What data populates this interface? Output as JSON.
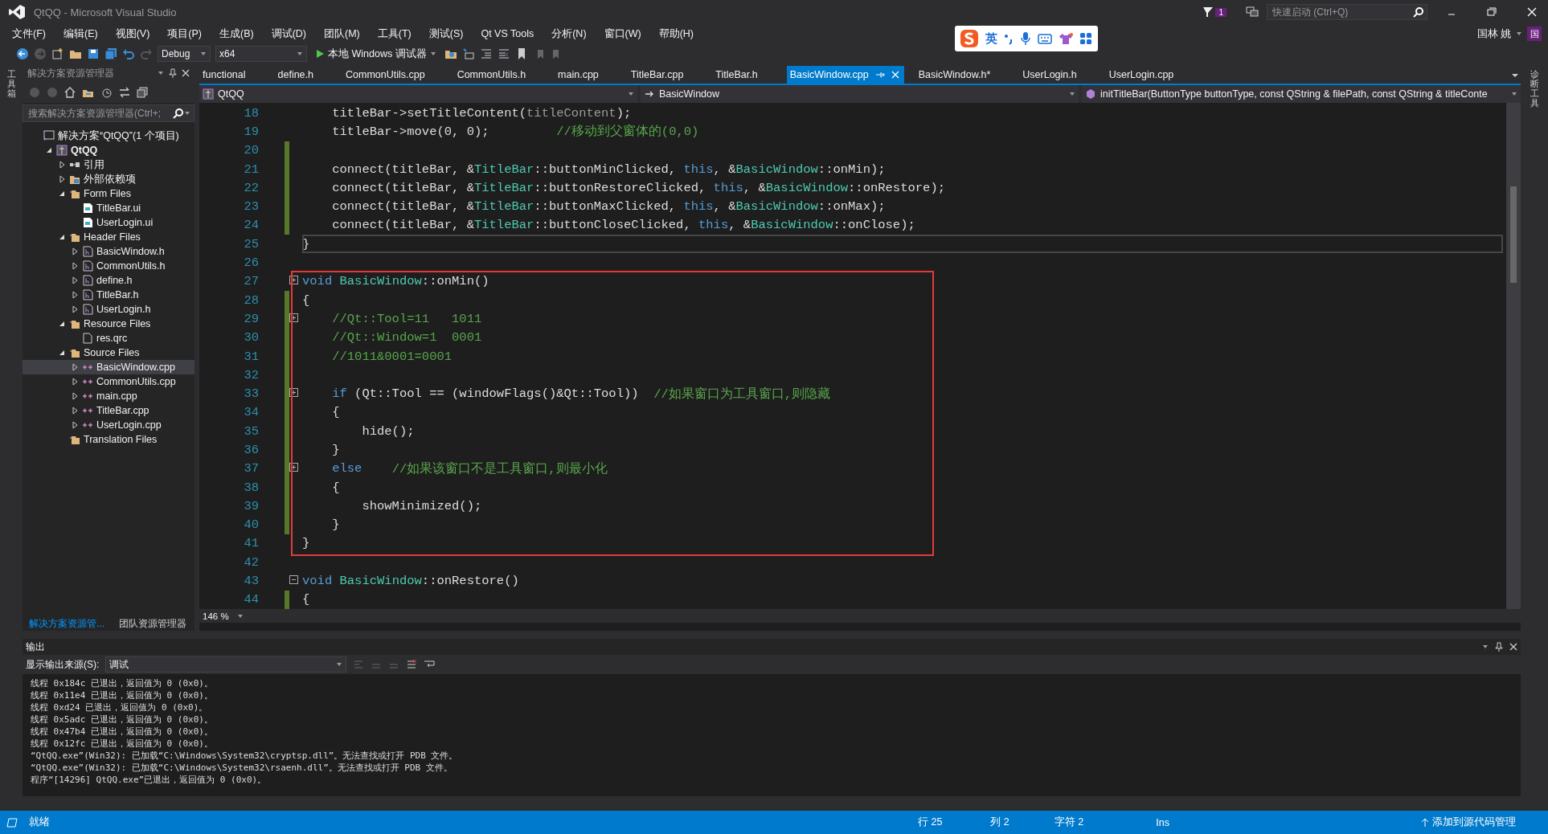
{
  "window": {
    "title": "QtQQ - Microsoft Visual Studio"
  },
  "notifications": {
    "count": "1"
  },
  "quick_launch": {
    "placeholder": "快速启动 (Ctrl+Q)"
  },
  "user": {
    "name": "国林 姚",
    "avatar": "国"
  },
  "ime_bar": {
    "mode": "英"
  },
  "menu": [
    "文件(F)",
    "编辑(E)",
    "视图(V)",
    "项目(P)",
    "生成(B)",
    "调试(D)",
    "团队(M)",
    "工具(T)",
    "测试(S)",
    "Qt VS Tools",
    "分析(N)",
    "窗口(W)",
    "帮助(H)"
  ],
  "toolbar": {
    "configuration": "Debug",
    "platform": "x64",
    "debugger": "本地 Windows 调试器"
  },
  "left_strip": {
    "label": "工具箱"
  },
  "right_strip": {
    "label": "诊断工具"
  },
  "solution_explorer": {
    "title": "解决方案资源管理器",
    "search": {
      "placeholder": "搜索解决方案资源管理器(Ctrl+;"
    },
    "tree": [
      {
        "label": "解决方案“QtQQ”(1 个项目)",
        "kind": "solution",
        "selected": false,
        "children": [
          {
            "label": "QtQQ",
            "kind": "project",
            "expanded": true,
            "selected": false,
            "children": [
              {
                "label": "引用",
                "kind": "references",
                "expanded": false,
                "selected": false
              },
              {
                "label": "外部依赖项",
                "kind": "external",
                "expanded": false,
                "selected": false
              },
              {
                "label": "Form Files",
                "kind": "folder",
                "expanded": true,
                "selected": false,
                "children": [
                  {
                    "label": "TitleBar.ui",
                    "kind": "ui",
                    "selected": false
                  },
                  {
                    "label": "UserLogin.ui",
                    "kind": "ui",
                    "selected": false
                  }
                ]
              },
              {
                "label": "Header Files",
                "kind": "folder",
                "expanded": true,
                "selected": false,
                "children": [
                  {
                    "label": "BasicWindow.h",
                    "kind": "header",
                    "expanded": false,
                    "selected": false
                  },
                  {
                    "label": "CommonUtils.h",
                    "kind": "header",
                    "expanded": false,
                    "selected": false
                  },
                  {
                    "label": "define.h",
                    "kind": "header",
                    "expanded": false,
                    "selected": false
                  },
                  {
                    "label": "TitleBar.h",
                    "kind": "header",
                    "expanded": false,
                    "selected": false
                  },
                  {
                    "label": "UserLogin.h",
                    "kind": "header",
                    "expanded": false,
                    "selected": false
                  }
                ]
              },
              {
                "label": "Resource Files",
                "kind": "folder",
                "expanded": true,
                "selected": false,
                "children": [
                  {
                    "label": "res.qrc",
                    "kind": "file",
                    "selected": false
                  }
                ]
              },
              {
                "label": "Source Files",
                "kind": "folder",
                "expanded": true,
                "selected": false,
                "children": [
                  {
                    "label": "BasicWindow.cpp",
                    "kind": "source",
                    "expanded": false,
                    "selected": true
                  },
                  {
                    "label": "CommonUtils.cpp",
                    "kind": "source",
                    "expanded": false,
                    "selected": false
                  },
                  {
                    "label": "main.cpp",
                    "kind": "source",
                    "expanded": false,
                    "selected": false
                  },
                  {
                    "label": "TitleBar.cpp",
                    "kind": "source",
                    "expanded": false,
                    "selected": false
                  },
                  {
                    "label": "UserLogin.cpp",
                    "kind": "source",
                    "expanded": false,
                    "selected": false
                  }
                ]
              },
              {
                "label": "Translation Files",
                "kind": "folder",
                "selected": false
              }
            ]
          }
        ]
      }
    ],
    "tabs": [
      {
        "label": "解决方案资源管...",
        "selected": true
      },
      {
        "label": "团队资源管理器",
        "selected": false
      }
    ]
  },
  "editor": {
    "tabs": [
      {
        "label": "functional",
        "selected": false
      },
      {
        "label": "define.h",
        "selected": false
      },
      {
        "label": "CommonUtils.cpp",
        "selected": false
      },
      {
        "label": "CommonUtils.h",
        "selected": false
      },
      {
        "label": "main.cpp",
        "selected": false
      },
      {
        "label": "TitleBar.cpp",
        "selected": false
      },
      {
        "label": "TitleBar.h",
        "selected": false
      },
      {
        "label": "BasicWindow.cpp",
        "selected": true
      },
      {
        "label": "BasicWindow.h*",
        "selected": false
      },
      {
        "label": "UserLogin.h",
        "selected": false
      },
      {
        "label": "UserLogin.cpp",
        "selected": false
      }
    ],
    "nav": {
      "project": "QtQQ",
      "class": "BasicWindow",
      "member": "initTitleBar(ButtonType buttonType, const QString & filePath, const QString & titleConte"
    },
    "lines": [
      {
        "number": "18",
        "changed": false,
        "current": false,
        "boxed": false,
        "tokens": [
          {
            "kind": "text",
            "text": "    titleBar->setTitleContent("
          },
          {
            "kind": "param",
            "text": "titleContent"
          },
          {
            "kind": "text",
            "text": ");"
          }
        ]
      },
      {
        "number": "19",
        "changed": false,
        "current": false,
        "boxed": false,
        "tokens": [
          {
            "kind": "text",
            "text": "    titleBar->move(0, 0);         "
          },
          {
            "kind": "comment",
            "text": "//移动到父窗体的(0,0)"
          }
        ]
      },
      {
        "number": "20",
        "changed": true,
        "current": false,
        "boxed": false
      },
      {
        "number": "21",
        "changed": true,
        "current": false,
        "boxed": false,
        "tokens": [
          {
            "kind": "text",
            "text": "    connect(titleBar, &"
          },
          {
            "kind": "type",
            "text": "TitleBar"
          },
          {
            "kind": "text",
            "text": "::buttonMinClicked, "
          },
          {
            "kind": "keyword",
            "text": "this"
          },
          {
            "kind": "text",
            "text": ", &"
          },
          {
            "kind": "type",
            "text": "BasicWindow"
          },
          {
            "kind": "text",
            "text": "::onMin);"
          }
        ]
      },
      {
        "number": "22",
        "changed": true,
        "current": false,
        "boxed": false,
        "tokens": [
          {
            "kind": "text",
            "text": "    connect(titleBar, &"
          },
          {
            "kind": "type",
            "text": "TitleBar"
          },
          {
            "kind": "text",
            "text": "::buttonRestoreClicked, "
          },
          {
            "kind": "keyword",
            "text": "this"
          },
          {
            "kind": "text",
            "text": ", &"
          },
          {
            "kind": "type",
            "text": "BasicWindow"
          },
          {
            "kind": "text",
            "text": "::onRestore);"
          }
        ]
      },
      {
        "number": "23",
        "changed": true,
        "current": false,
        "boxed": false,
        "tokens": [
          {
            "kind": "text",
            "text": "    connect(titleBar, &"
          },
          {
            "kind": "type",
            "text": "TitleBar"
          },
          {
            "kind": "text",
            "text": "::buttonMaxClicked, "
          },
          {
            "kind": "keyword",
            "text": "this"
          },
          {
            "kind": "text",
            "text": ", &"
          },
          {
            "kind": "type",
            "text": "BasicWindow"
          },
          {
            "kind": "text",
            "text": "::onMax);"
          }
        ]
      },
      {
        "number": "24",
        "changed": true,
        "current": false,
        "boxed": false,
        "tokens": [
          {
            "kind": "text",
            "text": "    connect(titleBar, &"
          },
          {
            "kind": "type",
            "text": "TitleBar"
          },
          {
            "kind": "text",
            "text": "::buttonCloseClicked, "
          },
          {
            "kind": "keyword",
            "text": "this"
          },
          {
            "kind": "text",
            "text": ", &"
          },
          {
            "kind": "type",
            "text": "BasicWindow"
          },
          {
            "kind": "text",
            "text": "::onClose);"
          }
        ]
      },
      {
        "number": "25",
        "changed": false,
        "current": true,
        "boxed": false,
        "tokens": [
          {
            "kind": "text",
            "text": "}"
          }
        ]
      },
      {
        "number": "26",
        "changed": false,
        "current": false,
        "boxed": false
      },
      {
        "number": "27",
        "changed": false,
        "current": false,
        "boxed": true,
        "fold": {
          "expanded": false
        },
        "tokens": [
          {
            "kind": "keyword",
            "text": "void "
          },
          {
            "kind": "type",
            "text": "BasicWindow"
          },
          {
            "kind": "text",
            "text": "::onMin()"
          }
        ]
      },
      {
        "number": "28",
        "changed": true,
        "current": false,
        "boxed": true,
        "tokens": [
          {
            "kind": "text",
            "text": "{"
          }
        ]
      },
      {
        "number": "29",
        "changed": true,
        "current": false,
        "boxed": true,
        "fold": {
          "expanded": false
        },
        "tokens": [
          {
            "kind": "comment",
            "text": "    //Qt::Tool=11   1011"
          }
        ]
      },
      {
        "number": "30",
        "changed": true,
        "current": false,
        "boxed": true,
        "tokens": [
          {
            "kind": "comment",
            "text": "    //Qt::Window=1  0001"
          }
        ]
      },
      {
        "number": "31",
        "changed": true,
        "current": false,
        "boxed": true,
        "tokens": [
          {
            "kind": "comment",
            "text": "    //1011&0001=0001"
          }
        ]
      },
      {
        "number": "32",
        "changed": true,
        "current": false,
        "boxed": true
      },
      {
        "number": "33",
        "changed": true,
        "current": false,
        "boxed": true,
        "fold": {
          "expanded": false
        },
        "tokens": [
          {
            "kind": "keyword",
            "text": "    if"
          },
          {
            "kind": "text",
            "text": " (Qt::Tool == (windowFlags()&Qt::Tool))  "
          },
          {
            "kind": "comment",
            "text": "//如果窗口为工具窗口,则隐藏"
          }
        ]
      },
      {
        "number": "34",
        "changed": true,
        "current": false,
        "boxed": true,
        "tokens": [
          {
            "kind": "text",
            "text": "    {"
          }
        ]
      },
      {
        "number": "35",
        "changed": true,
        "current": false,
        "boxed": true,
        "tokens": [
          {
            "kind": "text",
            "text": "        hide();"
          }
        ]
      },
      {
        "number": "36",
        "changed": true,
        "current": false,
        "boxed": true,
        "tokens": [
          {
            "kind": "text",
            "text": "    }"
          }
        ]
      },
      {
        "number": "37",
        "changed": true,
        "current": false,
        "boxed": true,
        "fold": {
          "expanded": false
        },
        "tokens": [
          {
            "kind": "keyword",
            "text": "    else"
          },
          {
            "kind": "comment",
            "text": "    //如果该窗口不是工具窗口,则最小化"
          }
        ]
      },
      {
        "number": "38",
        "changed": true,
        "current": false,
        "boxed": true,
        "tokens": [
          {
            "kind": "text",
            "text": "    {"
          }
        ]
      },
      {
        "number": "39",
        "changed": true,
        "current": false,
        "boxed": true,
        "tokens": [
          {
            "kind": "text",
            "text": "        showMinimized();"
          }
        ]
      },
      {
        "number": "40",
        "changed": true,
        "current": false,
        "boxed": true,
        "tokens": [
          {
            "kind": "text",
            "text": "    }"
          }
        ]
      },
      {
        "number": "41",
        "changed": false,
        "current": false,
        "boxed": true,
        "tokens": [
          {
            "kind": "text",
            "text": "}"
          }
        ]
      },
      {
        "number": "42",
        "changed": false,
        "current": false,
        "boxed": false
      },
      {
        "number": "43",
        "changed": false,
        "current": false,
        "boxed": false,
        "fold": {
          "expanded": true
        },
        "tokens": [
          {
            "kind": "keyword",
            "text": "void "
          },
          {
            "kind": "type",
            "text": "BasicWindow"
          },
          {
            "kind": "text",
            "text": "::onRestore()"
          }
        ]
      },
      {
        "number": "44",
        "changed": true,
        "current": false,
        "boxed": false,
        "tokens": [
          {
            "kind": "text",
            "text": "{"
          }
        ]
      }
    ],
    "zoom": "146 %"
  },
  "output": {
    "title": "输出",
    "source_label": "显示输出来源(S):",
    "source": "调试",
    "lines": [
      "线程 0x184c 已退出，返回值为 0 (0x0)。",
      "线程 0x11e4 已退出，返回值为 0 (0x0)。",
      "线程 0xd24 已退出，返回值为 0 (0x0)。",
      "线程 0x5adc 已退出，返回值为 0 (0x0)。",
      "线程 0x47b4 已退出，返回值为 0 (0x0)。",
      "线程 0x12fc 已退出，返回值为 0 (0x0)。",
      "“QtQQ.exe”(Win32): 已加载“C:\\Windows\\System32\\cryptsp.dll”。无法查找或打开 PDB 文件。",
      "“QtQQ.exe”(Win32): 已加载“C:\\Windows\\System32\\rsaenh.dll”。无法查找或打开 PDB 文件。",
      "程序“[14296] QtQQ.exe”已退出，返回值为 0 (0x0)。"
    ]
  },
  "status_bar": {
    "state": "就绪",
    "line": "行 25",
    "column": "列 2",
    "char": "字符 2",
    "mode": "Ins",
    "source_control": "添加到源代码管理"
  }
}
